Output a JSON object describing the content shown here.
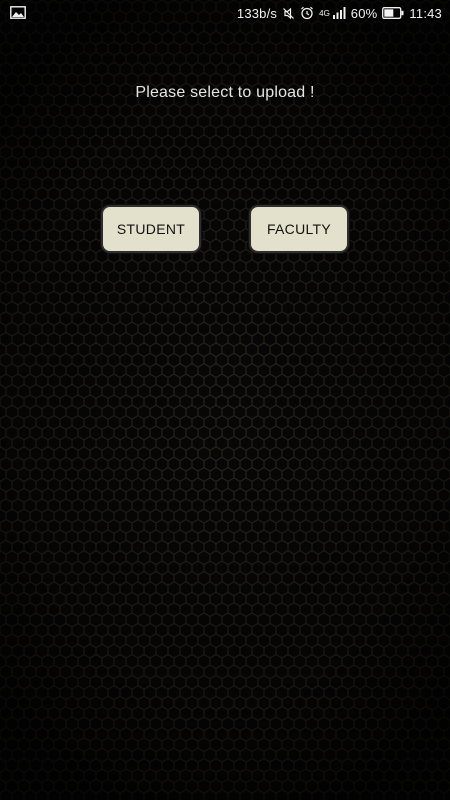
{
  "status_bar": {
    "left_icon": "image-icon",
    "network_speed": "133b/s",
    "mute_icon": "vibrate-off-icon",
    "alarm_icon": "alarm-clock-icon",
    "network_type": "4G",
    "signal_icon": "signal-icon",
    "battery_percent": "60%",
    "battery_level": 0.6,
    "time": "11:43"
  },
  "main": {
    "prompt": "Please select to upload !",
    "student_button": "STUDENT",
    "faculty_button": "FACULTY"
  },
  "colors": {
    "background": "#050505",
    "hex_stroke": "#2a2620",
    "button_fill": "#e3e1cc",
    "button_border": "#2e2e2e",
    "text_light": "#e6e6e6"
  }
}
